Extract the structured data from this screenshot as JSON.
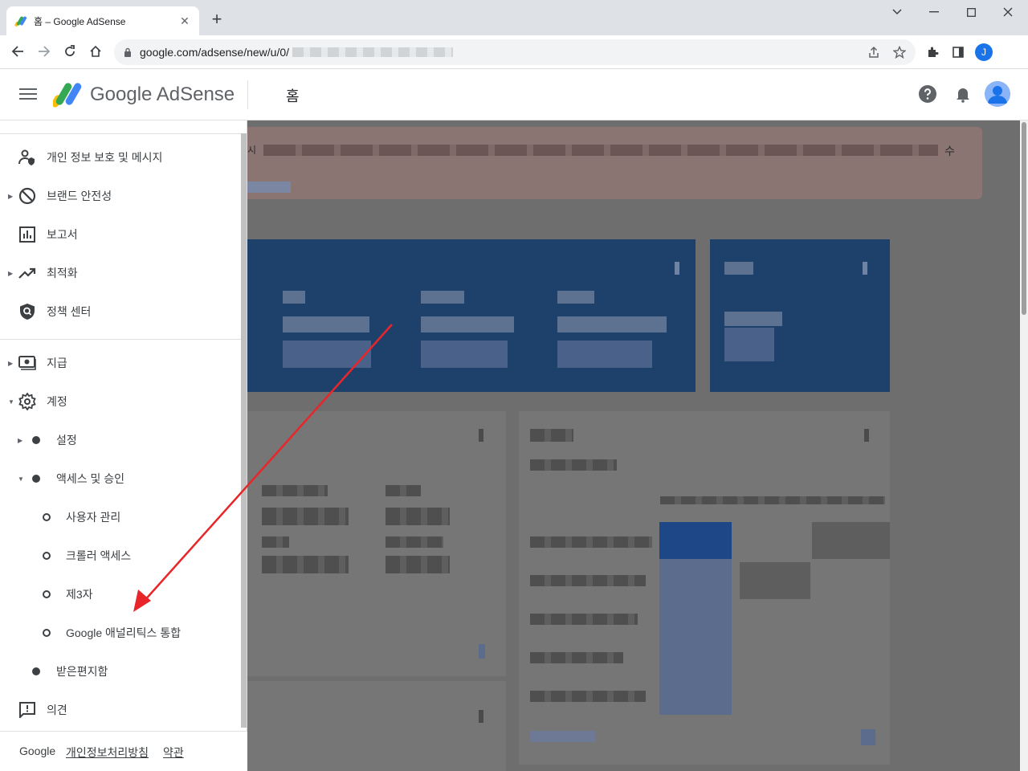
{
  "browser": {
    "tab_title": "홈 – Google AdSense",
    "url": "google.com/adsense/new/u/0/",
    "profile_initial": "J"
  },
  "header": {
    "brand": "Google AdSense",
    "page_title": "홈"
  },
  "sidebar": {
    "items": [
      {
        "label": "개인 정보 보호 및 메시지",
        "icon": "privacy-person-icon"
      },
      {
        "label": "브랜드 안전성",
        "icon": "block-icon"
      },
      {
        "label": "보고서",
        "icon": "bar-chart-icon"
      },
      {
        "label": "최적화",
        "icon": "trending-up-icon"
      },
      {
        "label": "정책 센터",
        "icon": "policy-shield-icon"
      },
      {
        "label": "지급",
        "icon": "payments-icon"
      },
      {
        "label": "계정",
        "icon": "gear-icon"
      },
      {
        "label": "설정"
      },
      {
        "label": "액세스 및 승인"
      },
      {
        "label": "사용자 관리"
      },
      {
        "label": "크롤러 액세스"
      },
      {
        "label": "제3자"
      },
      {
        "label": "Google 애널리틱스 통합"
      },
      {
        "label": "받은편지함"
      },
      {
        "label": "의견",
        "icon": "feedback-icon"
      }
    ],
    "footer": {
      "google": "Google",
      "privacy": "개인정보처리방침",
      "terms": "약관"
    }
  },
  "main": {
    "banner_end_text": "수",
    "banner_mark": "시"
  },
  "colors": {
    "annotation_arrow": "#e8262a",
    "card_blue": "#1e416c",
    "google_blue": "#4285f4",
    "google_yellow": "#fbbc04",
    "google_green": "#34a853"
  }
}
